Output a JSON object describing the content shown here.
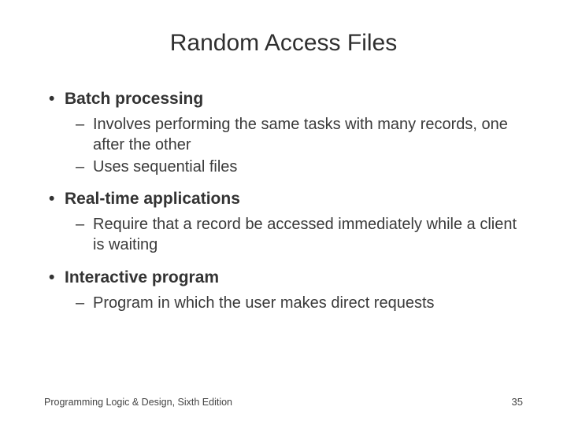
{
  "title": "Random Access Files",
  "bullets": [
    {
      "label": "Batch processing",
      "sub": [
        "Involves performing the same tasks with many records, one after the other",
        "Uses sequential files"
      ]
    },
    {
      "label": "Real-time applications",
      "sub": [
        "Require that a record be accessed immediately while a client is waiting"
      ]
    },
    {
      "label": "Interactive program",
      "sub": [
        "Program in which the user makes direct requests"
      ]
    }
  ],
  "footer": {
    "text": "Programming Logic & Design, Sixth Edition",
    "page": "35"
  }
}
